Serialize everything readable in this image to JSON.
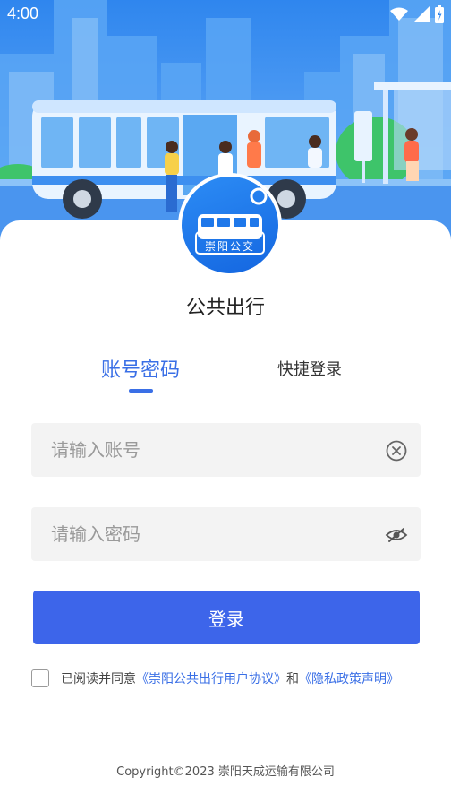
{
  "status_bar": {
    "time": "4:00",
    "icons": [
      "wifi-icon",
      "signal-icon",
      "battery-icon"
    ]
  },
  "hero": {
    "illustration": "city-bus-stop-illustration",
    "logo_text": "崇阳公交"
  },
  "app_name": "公共出行",
  "tabs": [
    {
      "label": "账号密码",
      "active": true
    },
    {
      "label": "快捷登录",
      "active": false
    }
  ],
  "form": {
    "account_placeholder": "请输入账号",
    "password_placeholder": "请输入密码",
    "account_clear_icon": "clear-circle-icon",
    "password_toggle_icon": "eye-off-icon",
    "login_label": "登录"
  },
  "agreement": {
    "checked": false,
    "prefix": "已阅读并同意",
    "user_agreement": "《崇阳公共出行用户协议》",
    "conjunction": "和",
    "privacy_policy": "《隐私政策声明》"
  },
  "footer": {
    "copyright": "Copyright©2023 崇阳天成运输有限公司"
  },
  "colors": {
    "accent": "#3a6fe6",
    "button": "#3d65ea",
    "hero_sky": "#2f86ee",
    "field_bg": "#f3f3f3"
  }
}
